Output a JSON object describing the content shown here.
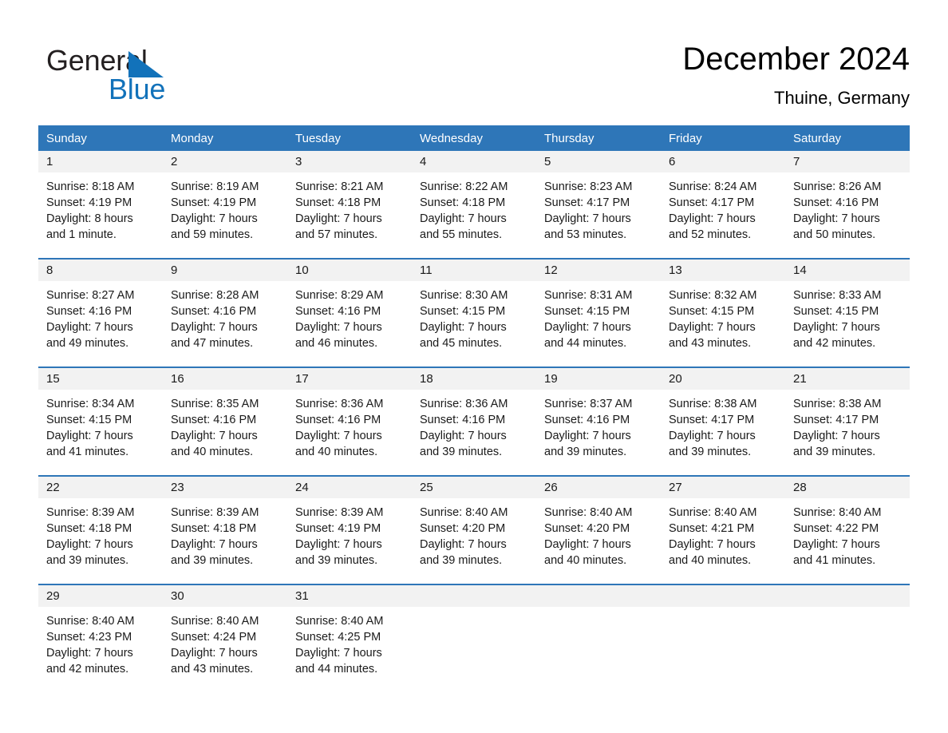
{
  "brand": {
    "name_part1": "General",
    "name_part2": "Blue",
    "accent_color": "#1272ba",
    "header_color": "#2e76b8"
  },
  "header": {
    "title": "December 2024",
    "subtitle": "Thuine, Germany"
  },
  "weekday_headers": [
    "Sunday",
    "Monday",
    "Tuesday",
    "Wednesday",
    "Thursday",
    "Friday",
    "Saturday"
  ],
  "weeks": [
    {
      "days": [
        {
          "num": "1",
          "sunrise": "Sunrise: 8:18 AM",
          "sunset": "Sunset: 4:19 PM",
          "daylight1": "Daylight: 8 hours",
          "daylight2": "and 1 minute."
        },
        {
          "num": "2",
          "sunrise": "Sunrise: 8:19 AM",
          "sunset": "Sunset: 4:19 PM",
          "daylight1": "Daylight: 7 hours",
          "daylight2": "and 59 minutes."
        },
        {
          "num": "3",
          "sunrise": "Sunrise: 8:21 AM",
          "sunset": "Sunset: 4:18 PM",
          "daylight1": "Daylight: 7 hours",
          "daylight2": "and 57 minutes."
        },
        {
          "num": "4",
          "sunrise": "Sunrise: 8:22 AM",
          "sunset": "Sunset: 4:18 PM",
          "daylight1": "Daylight: 7 hours",
          "daylight2": "and 55 minutes."
        },
        {
          "num": "5",
          "sunrise": "Sunrise: 8:23 AM",
          "sunset": "Sunset: 4:17 PM",
          "daylight1": "Daylight: 7 hours",
          "daylight2": "and 53 minutes."
        },
        {
          "num": "6",
          "sunrise": "Sunrise: 8:24 AM",
          "sunset": "Sunset: 4:17 PM",
          "daylight1": "Daylight: 7 hours",
          "daylight2": "and 52 minutes."
        },
        {
          "num": "7",
          "sunrise": "Sunrise: 8:26 AM",
          "sunset": "Sunset: 4:16 PM",
          "daylight1": "Daylight: 7 hours",
          "daylight2": "and 50 minutes."
        }
      ]
    },
    {
      "days": [
        {
          "num": "8",
          "sunrise": "Sunrise: 8:27 AM",
          "sunset": "Sunset: 4:16 PM",
          "daylight1": "Daylight: 7 hours",
          "daylight2": "and 49 minutes."
        },
        {
          "num": "9",
          "sunrise": "Sunrise: 8:28 AM",
          "sunset": "Sunset: 4:16 PM",
          "daylight1": "Daylight: 7 hours",
          "daylight2": "and 47 minutes."
        },
        {
          "num": "10",
          "sunrise": "Sunrise: 8:29 AM",
          "sunset": "Sunset: 4:16 PM",
          "daylight1": "Daylight: 7 hours",
          "daylight2": "and 46 minutes."
        },
        {
          "num": "11",
          "sunrise": "Sunrise: 8:30 AM",
          "sunset": "Sunset: 4:15 PM",
          "daylight1": "Daylight: 7 hours",
          "daylight2": "and 45 minutes."
        },
        {
          "num": "12",
          "sunrise": "Sunrise: 8:31 AM",
          "sunset": "Sunset: 4:15 PM",
          "daylight1": "Daylight: 7 hours",
          "daylight2": "and 44 minutes."
        },
        {
          "num": "13",
          "sunrise": "Sunrise: 8:32 AM",
          "sunset": "Sunset: 4:15 PM",
          "daylight1": "Daylight: 7 hours",
          "daylight2": "and 43 minutes."
        },
        {
          "num": "14",
          "sunrise": "Sunrise: 8:33 AM",
          "sunset": "Sunset: 4:15 PM",
          "daylight1": "Daylight: 7 hours",
          "daylight2": "and 42 minutes."
        }
      ]
    },
    {
      "days": [
        {
          "num": "15",
          "sunrise": "Sunrise: 8:34 AM",
          "sunset": "Sunset: 4:15 PM",
          "daylight1": "Daylight: 7 hours",
          "daylight2": "and 41 minutes."
        },
        {
          "num": "16",
          "sunrise": "Sunrise: 8:35 AM",
          "sunset": "Sunset: 4:16 PM",
          "daylight1": "Daylight: 7 hours",
          "daylight2": "and 40 minutes."
        },
        {
          "num": "17",
          "sunrise": "Sunrise: 8:36 AM",
          "sunset": "Sunset: 4:16 PM",
          "daylight1": "Daylight: 7 hours",
          "daylight2": "and 40 minutes."
        },
        {
          "num": "18",
          "sunrise": "Sunrise: 8:36 AM",
          "sunset": "Sunset: 4:16 PM",
          "daylight1": "Daylight: 7 hours",
          "daylight2": "and 39 minutes."
        },
        {
          "num": "19",
          "sunrise": "Sunrise: 8:37 AM",
          "sunset": "Sunset: 4:16 PM",
          "daylight1": "Daylight: 7 hours",
          "daylight2": "and 39 minutes."
        },
        {
          "num": "20",
          "sunrise": "Sunrise: 8:38 AM",
          "sunset": "Sunset: 4:17 PM",
          "daylight1": "Daylight: 7 hours",
          "daylight2": "and 39 minutes."
        },
        {
          "num": "21",
          "sunrise": "Sunrise: 8:38 AM",
          "sunset": "Sunset: 4:17 PM",
          "daylight1": "Daylight: 7 hours",
          "daylight2": "and 39 minutes."
        }
      ]
    },
    {
      "days": [
        {
          "num": "22",
          "sunrise": "Sunrise: 8:39 AM",
          "sunset": "Sunset: 4:18 PM",
          "daylight1": "Daylight: 7 hours",
          "daylight2": "and 39 minutes."
        },
        {
          "num": "23",
          "sunrise": "Sunrise: 8:39 AM",
          "sunset": "Sunset: 4:18 PM",
          "daylight1": "Daylight: 7 hours",
          "daylight2": "and 39 minutes."
        },
        {
          "num": "24",
          "sunrise": "Sunrise: 8:39 AM",
          "sunset": "Sunset: 4:19 PM",
          "daylight1": "Daylight: 7 hours",
          "daylight2": "and 39 minutes."
        },
        {
          "num": "25",
          "sunrise": "Sunrise: 8:40 AM",
          "sunset": "Sunset: 4:20 PM",
          "daylight1": "Daylight: 7 hours",
          "daylight2": "and 39 minutes."
        },
        {
          "num": "26",
          "sunrise": "Sunrise: 8:40 AM",
          "sunset": "Sunset: 4:20 PM",
          "daylight1": "Daylight: 7 hours",
          "daylight2": "and 40 minutes."
        },
        {
          "num": "27",
          "sunrise": "Sunrise: 8:40 AM",
          "sunset": "Sunset: 4:21 PM",
          "daylight1": "Daylight: 7 hours",
          "daylight2": "and 40 minutes."
        },
        {
          "num": "28",
          "sunrise": "Sunrise: 8:40 AM",
          "sunset": "Sunset: 4:22 PM",
          "daylight1": "Daylight: 7 hours",
          "daylight2": "and 41 minutes."
        }
      ]
    },
    {
      "days": [
        {
          "num": "29",
          "sunrise": "Sunrise: 8:40 AM",
          "sunset": "Sunset: 4:23 PM",
          "daylight1": "Daylight: 7 hours",
          "daylight2": "and 42 minutes."
        },
        {
          "num": "30",
          "sunrise": "Sunrise: 8:40 AM",
          "sunset": "Sunset: 4:24 PM",
          "daylight1": "Daylight: 7 hours",
          "daylight2": "and 43 minutes."
        },
        {
          "num": "31",
          "sunrise": "Sunrise: 8:40 AM",
          "sunset": "Sunset: 4:25 PM",
          "daylight1": "Daylight: 7 hours",
          "daylight2": "and 44 minutes."
        },
        {
          "num": "",
          "sunrise": "",
          "sunset": "",
          "daylight1": "",
          "daylight2": ""
        },
        {
          "num": "",
          "sunrise": "",
          "sunset": "",
          "daylight1": "",
          "daylight2": ""
        },
        {
          "num": "",
          "sunrise": "",
          "sunset": "",
          "daylight1": "",
          "daylight2": ""
        },
        {
          "num": "",
          "sunrise": "",
          "sunset": "",
          "daylight1": "",
          "daylight2": ""
        }
      ]
    }
  ]
}
